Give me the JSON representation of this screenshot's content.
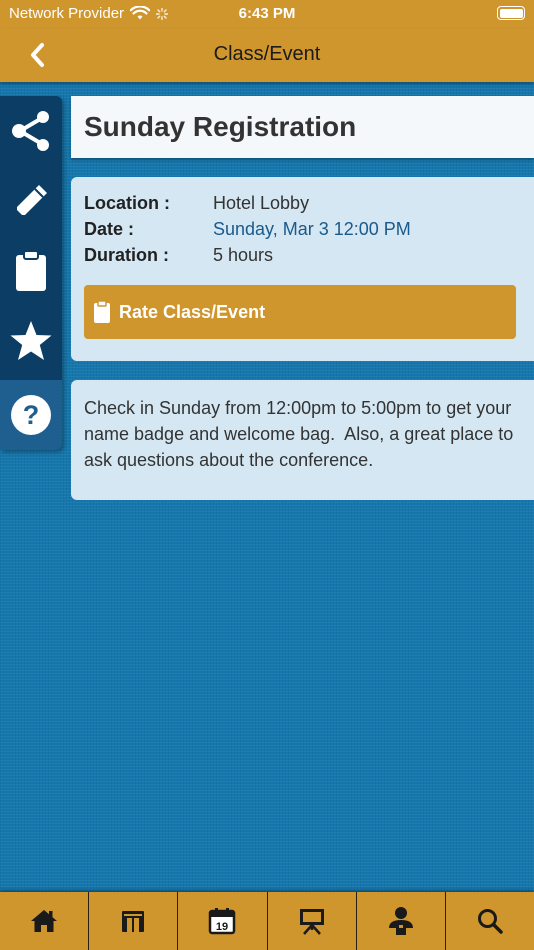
{
  "status_bar": {
    "carrier": "Network Provider",
    "time": "6:43 PM"
  },
  "nav": {
    "title": "Class/Event",
    "back_icon": "chevron-left-icon"
  },
  "sidebar": {
    "items": [
      {
        "icon": "share-icon"
      },
      {
        "icon": "pencil-icon"
      },
      {
        "icon": "clipboard-icon"
      },
      {
        "icon": "star-icon"
      },
      {
        "icon": "help-icon",
        "active": true
      }
    ]
  },
  "event": {
    "title": "Sunday Registration",
    "location_label": "Location :",
    "location_value": "Hotel Lobby",
    "date_label": "Date :",
    "date_value": "Sunday, Mar 3 12:00 PM",
    "duration_label": "Duration :",
    "duration_value": "5 hours",
    "rate_button_label": "Rate Class/Event",
    "description": "Check in Sunday from 12:00pm to 5:00pm to get your name badge and welcome bag.  Also, a great place to ask questions about the conference."
  },
  "tabbar": {
    "items": [
      {
        "icon": "home-icon"
      },
      {
        "icon": "exhibitor-booth-icon"
      },
      {
        "icon": "calendar-icon",
        "text": "19"
      },
      {
        "icon": "presentation-board-icon"
      },
      {
        "icon": "speaker-icon"
      },
      {
        "icon": "search-icon"
      }
    ]
  },
  "colors": {
    "accent": "#cf962e",
    "background": "#1577ad",
    "sidebar": "#0c3d64",
    "card": "#d4e7f2"
  }
}
